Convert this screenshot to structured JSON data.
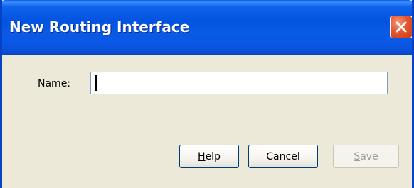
{
  "dialog": {
    "title": "New Routing Interface",
    "close_icon": "close-icon"
  },
  "form": {
    "name_label": "Name:",
    "name_value": ""
  },
  "buttons": {
    "help": {
      "mnemonic": "H",
      "rest": "elp",
      "enabled": true
    },
    "cancel": {
      "label": "Cancel",
      "enabled": true
    },
    "save": {
      "mnemonic": "S",
      "rest": "ave",
      "enabled": false
    }
  },
  "colors": {
    "titlebar": "#0253e0",
    "close_button": "#e4572e",
    "window_bg": "#ece9d8",
    "input_border": "#7f9db9",
    "disabled_text": "#a19f91"
  }
}
